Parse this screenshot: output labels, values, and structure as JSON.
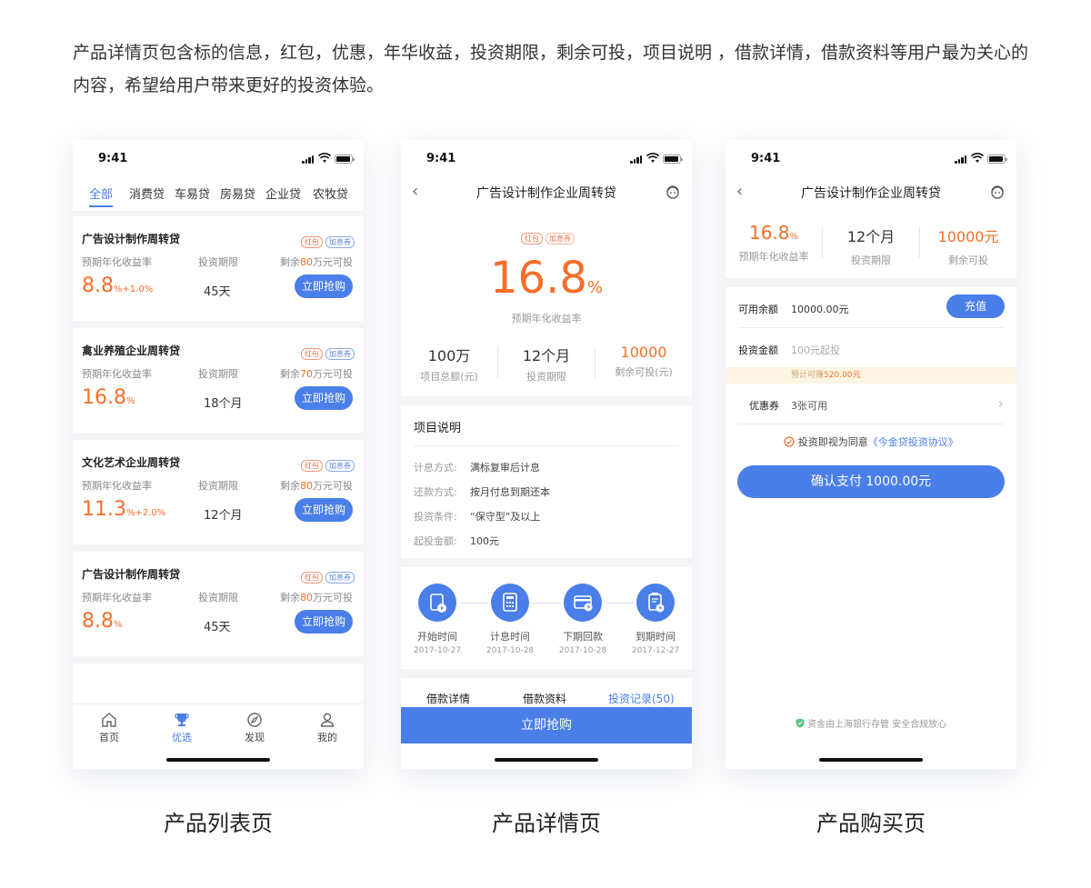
{
  "intro": "产品详情页包含标的信息，红包，优惠，年华收益，投资期限，剩余可投，项目说明 ，借款详情，借款资料等用户最为关心的内容，希望给用户带来更好的投资体验。",
  "status_time": "9:41",
  "captions": [
    "产品列表页",
    "产品详情页",
    "产品购买页"
  ],
  "list_page": {
    "tabs": [
      "全部",
      "消费贷",
      "车易贷",
      "房易贷",
      "企业贷",
      "农牧贷"
    ],
    "tag_red": "红包",
    "tag_blue": "加息券",
    "rate_label": "预期年化收益率",
    "term_label": "投资期限",
    "remain_prefix": "剩余",
    "remain_suffix": "万元可投",
    "buy_label": "立即抢购",
    "rate_unit": "%",
    "items": [
      {
        "title": "广告设计制作周转贷",
        "rate": "8.8",
        "bonus": "+1.0%",
        "term": "45天",
        "remain": "80"
      },
      {
        "title": "禽业养殖企业周转贷",
        "rate": "16.8",
        "bonus": "",
        "term": "18个月",
        "remain": "70"
      },
      {
        "title": "文化艺术企业周转贷",
        "rate": "11.3",
        "bonus": "+2.0%",
        "term": "12个月",
        "remain": "80"
      },
      {
        "title": "广告设计制作周转贷",
        "rate": "8.8",
        "bonus": "",
        "term": "45天",
        "remain": "80"
      }
    ],
    "tabbar": [
      {
        "label": "首页",
        "icon": "home-icon"
      },
      {
        "label": "优选",
        "icon": "trophy-icon"
      },
      {
        "label": "发现",
        "icon": "compass-icon"
      },
      {
        "label": "我的",
        "icon": "user-icon"
      }
    ]
  },
  "detail_page": {
    "nav_title": "广告设计制作企业周转贷",
    "tag_red": "红包",
    "tag_blue": "加息券",
    "rate": "16.8",
    "rate_unit": "%",
    "rate_label": "预期年化收益率",
    "stats": [
      {
        "value": "100万",
        "label": "项目总额(元)"
      },
      {
        "value": "12个月",
        "label": "投资期限"
      },
      {
        "value": "10000",
        "label": "剩余可投(元)"
      }
    ],
    "section_title": "项目说明",
    "details": [
      {
        "k": "计息方式:",
        "v": "满标复审后计息"
      },
      {
        "k": "还款方式:",
        "v": "按月付息到期还本"
      },
      {
        "k": "投资条件:",
        "v": "“保守型”及以上"
      },
      {
        "k": "起投金额:",
        "v": "100元"
      }
    ],
    "timeline": [
      {
        "name": "开始时间",
        "date": "2017-10-27",
        "icon": "play-doc-icon"
      },
      {
        "name": "计息时间",
        "date": "2017-10-28",
        "icon": "calculator-icon"
      },
      {
        "name": "下期回款",
        "date": "2017-10-28",
        "icon": "card-clock-icon"
      },
      {
        "name": "到期时间",
        "date": "2017-12-27",
        "icon": "clipboard-clock-icon"
      }
    ],
    "bottom_tabs": [
      "借款详情",
      "借款资料",
      "投资记录(50)"
    ],
    "buy_label": "立即抢购"
  },
  "purchase_page": {
    "nav_title": "广告设计制作企业周转贷",
    "rate": "16.8",
    "rate_unit": "%",
    "rate_label": "预期年化收益率",
    "term": "12个月",
    "term_label": "投资期限",
    "remain": "10000元",
    "remain_label": "剩余可投",
    "balance_label": "可用余额",
    "balance_value": "10000.00元",
    "recharge_label": "充值",
    "amount_label": "投资金额",
    "amount_placeholder": "100元起投",
    "earn_prefix": "预计可赚",
    "earn_value": "520.00元",
    "coupon_label": "优惠券",
    "coupon_value": "3张可用",
    "agree_text": "投资即视为同意",
    "agree_link": "《今金贷投资协议》",
    "confirm_label": "确认支付 1000.00元",
    "safe_text": "资金由上海银行存管 安全合规放心"
  },
  "colors": {
    "accent": "#4a7ee8",
    "orange": "#f56e2a"
  }
}
